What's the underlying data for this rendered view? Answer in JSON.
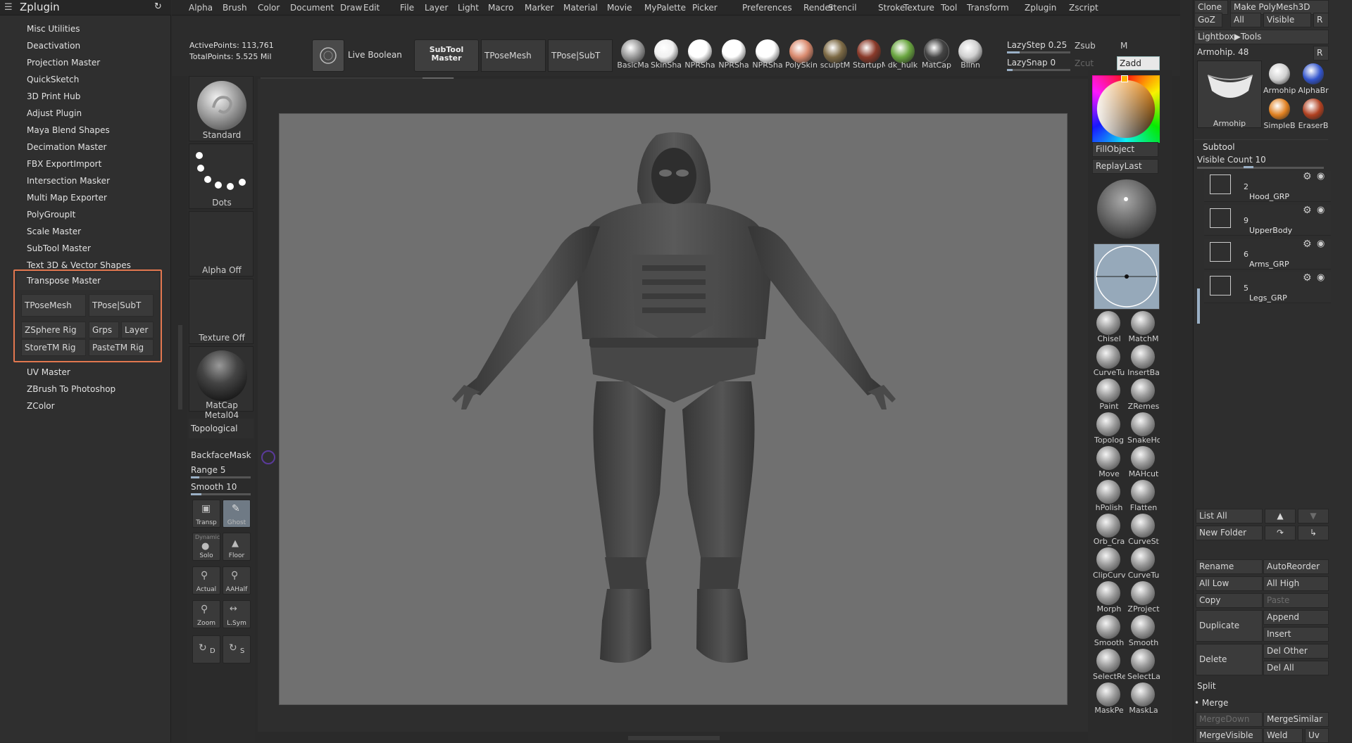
{
  "app": {
    "panel_title": "Zplugin"
  },
  "plugins": [
    "Misc Utilities",
    "Deactivation",
    "Projection Master",
    "QuickSketch",
    "3D Print Hub",
    "Adjust Plugin",
    "Maya Blend Shapes",
    "Decimation Master",
    "FBX ExportImport",
    "Intersection Masker",
    "Multi Map Exporter",
    "PolyGroupIt",
    "Scale Master",
    "SubTool Master",
    "Text 3D & Vector Shapes"
  ],
  "transpose_master": {
    "title": "Transpose Master",
    "tposemesh": "TPoseMesh",
    "tpose_subt": "TPose|SubT",
    "zsphere_rig": "ZSphere Rig",
    "grps": "Grps",
    "layer": "Layer",
    "storetm": "StoreTM Rig",
    "pastetm": "PasteTM Rig"
  },
  "plugins_after": [
    "UV Master",
    "ZBrush To Photoshop",
    "ZColor"
  ],
  "menu": [
    "Alpha",
    "Brush",
    "Color",
    "Document",
    "Draw",
    "Edit",
    "File",
    "Layer",
    "Light",
    "Macro",
    "Marker",
    "Material",
    "Movie",
    "MyPalette",
    "Picker",
    "Preferences",
    "Render",
    "Stencil",
    "Stroke",
    "Texture",
    "Tool",
    "Transform",
    "Zplugin",
    "Zscript"
  ],
  "stats": {
    "active_points": "ActivePoints: 113,761",
    "total_points": "TotalPoints: 5.525 Mil"
  },
  "topbar": {
    "live_boolean": "Live Boolean",
    "subtool_master": "SubTool Master",
    "tposemesh": "TPoseMesh",
    "tpose_subt": "TPose|SubT",
    "lazystep": "LazyStep 0.25",
    "lazysnap": "LazySnap 0",
    "zsub": "Zsub",
    "zcut": "Zcut",
    "m": "M",
    "zadd": "Zadd"
  },
  "materials": [
    {
      "label": "BasicMa",
      "color": "#9a9a9a"
    },
    {
      "label": "SkinSha",
      "color": "#f0f0f0"
    },
    {
      "label": "NPRSha",
      "color": "#ffffff"
    },
    {
      "label": "NPRSha",
      "color": "#ffffff"
    },
    {
      "label": "NPRSha",
      "color": "#ffffff"
    },
    {
      "label": "PolySkin",
      "color": "#d98a6e"
    },
    {
      "label": "sculptM",
      "color": "#7d6a45"
    },
    {
      "label": "StartupM",
      "color": "#8a3a2a"
    },
    {
      "label": "dk_hulk",
      "color": "#6aa640"
    },
    {
      "label": "MatCap",
      "color": "#444444"
    },
    {
      "label": "Blinn",
      "color": "#d0d0d0"
    }
  ],
  "left_tools": {
    "standard": "Standard",
    "dots": "Dots",
    "alpha_off": "Alpha Off",
    "texture_off": "Texture Off",
    "matcap": "MatCap Metal04",
    "topological": "Topological",
    "backfacemask": "BackfaceMask",
    "range": "Range 5",
    "smooth": "Smooth 10",
    "transp": "Transp",
    "ghost": "Ghost",
    "dynamic": "Dynamic",
    "solo": "Solo",
    "floor": "Floor",
    "actual": "Actual",
    "aahalf": "AAHalf",
    "zoom": "Zoom",
    "lsym": "L.Sym",
    "d": "D",
    "s": "S"
  },
  "right_brush_column": {
    "fillobject": "FillObject",
    "replaylast": "ReplayLast",
    "brushes": [
      [
        "Chisel",
        "MatchM"
      ],
      [
        "CurveTu",
        "InsertBa"
      ],
      [
        "Paint",
        "ZRemes"
      ],
      [
        "Topolog",
        "SnakeHo"
      ],
      [
        "Move",
        "MAHcut"
      ],
      [
        "hPolish",
        "Flatten"
      ],
      [
        "Orb_Cra",
        "CurveSt"
      ],
      [
        "ClipCurv",
        "CurveTu"
      ],
      [
        "Morph",
        "ZProject"
      ],
      [
        "Smooth",
        "Smooth"
      ],
      [
        "SelectRe",
        "SelectLa"
      ],
      [
        "MaskPe",
        "MaskLa"
      ]
    ]
  },
  "right_panel": {
    "clone": "Clone",
    "make_polymesh": "Make PolyMesh3D",
    "goz": "GoZ",
    "all": "All",
    "visible": "Visible",
    "r": "R",
    "lightbox_tools": "Lightbox▶Tools",
    "armohip": "Armohip. 48",
    "tool_thumbs": [
      "Armohip",
      "Armohip",
      "AlphaBr",
      "SimpleB",
      "EraserB"
    ],
    "subtool_title": "Subtool",
    "visible_count": "Visible Count 10",
    "subtools": [
      {
        "count": "2",
        "name": "Hood_GRP"
      },
      {
        "count": "9",
        "name": "UpperBody"
      },
      {
        "count": "6",
        "name": "Arms_GRP"
      },
      {
        "count": "5",
        "name": "Legs_GRP"
      }
    ],
    "list_all": "List All",
    "new_folder": "New Folder",
    "rename": "Rename",
    "autoreorder": "AutoReorder",
    "all_low": "All Low",
    "all_high": "All High",
    "copy": "Copy",
    "paste": "Paste",
    "duplicate": "Duplicate",
    "append": "Append",
    "insert": "Insert",
    "delete": "Delete",
    "del_other": "Del Other",
    "del_all": "Del All",
    "split": "Split",
    "merge": "Merge",
    "mergedown": "MergeDown",
    "mergesimilar": "MergeSimilar",
    "mergevisible": "MergeVisible",
    "weld": "Weld",
    "uv": "Uv"
  }
}
